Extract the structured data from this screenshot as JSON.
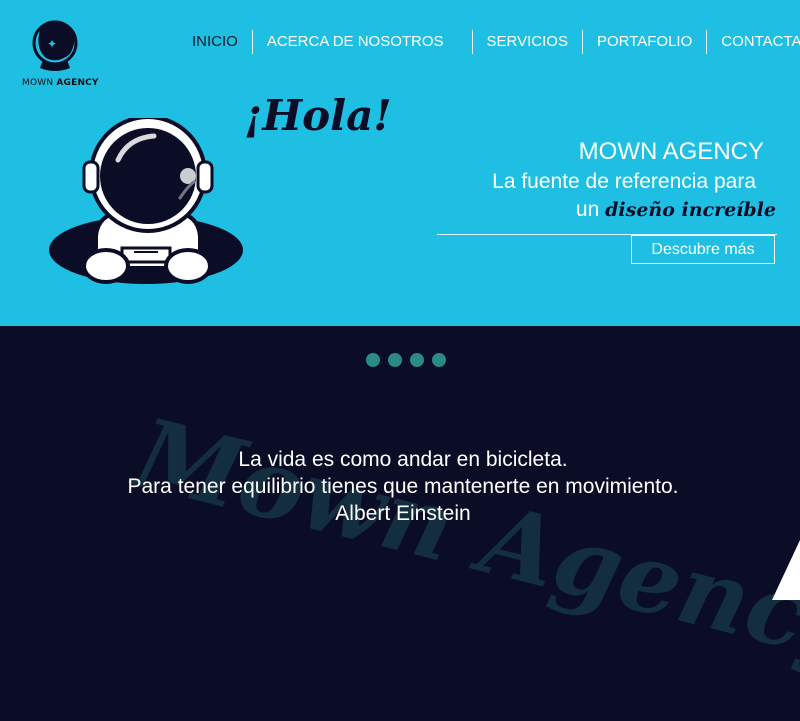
{
  "colors": {
    "hero_bg": "#1fbfe3",
    "dark_bg": "#0b0d26",
    "dot": "#2b8a86",
    "watermark": "#143040"
  },
  "logo": {
    "name_part1": "MOWN",
    "name_part2": "AGENCY",
    "icon": "astronaut-helmet-logo-icon"
  },
  "nav": {
    "items": [
      {
        "label": "INICIO",
        "active": true
      },
      {
        "label": "ACERCA DE NOSOTROS",
        "active": false
      },
      {
        "label": "SERVICIOS",
        "active": false
      },
      {
        "label": "PORTAFOLIO",
        "active": false
      },
      {
        "label": "CONTACTANOS",
        "active": false
      }
    ]
  },
  "hero": {
    "greeting": "¡Hola!",
    "brand": "MOWN AGENCY",
    "tagline1": "La fuente de referencia para",
    "tagline2_prefix": "un",
    "tagline2_cursive": "diseño increíble",
    "cta_label": "Descubre más",
    "illustration": "astronaut-in-hole-icon"
  },
  "carousel": {
    "dots": 4
  },
  "watermark": {
    "text": "Mown Agency"
  },
  "quote": {
    "line1": "La vida es como andar en bicicleta.",
    "line2": "Para tener equilibrio tienes que mantenerte en movimiento.",
    "author": "Albert Einstein"
  }
}
